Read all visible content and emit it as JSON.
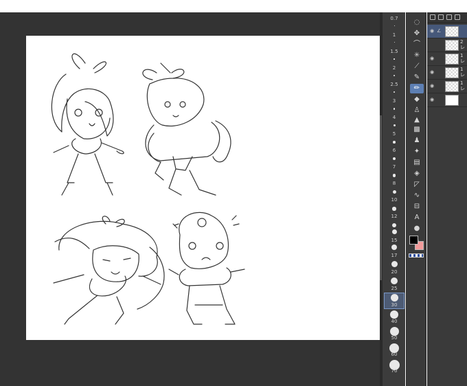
{
  "brush_sizes": [
    {
      "label": "0.7"
    },
    {
      "label": "1"
    },
    {
      "label": "1.5"
    },
    {
      "label": "2"
    },
    {
      "label": "2.5"
    },
    {
      "label": "3"
    },
    {
      "label": "4"
    },
    {
      "label": "5"
    },
    {
      "label": "6"
    },
    {
      "label": "7"
    },
    {
      "label": "8"
    },
    {
      "label": "10"
    },
    {
      "label": "12"
    },
    {
      "label": "15"
    },
    {
      "label": "17"
    },
    {
      "label": "20"
    },
    {
      "label": "25"
    },
    {
      "label": "30"
    },
    {
      "label": "40"
    },
    {
      "label": "50"
    },
    {
      "label": "60"
    },
    {
      "label": "70"
    }
  ],
  "selected_brush_size": "30",
  "tools": [
    {
      "name": "lasso-select-tool-icon",
      "glyph": "◌"
    },
    {
      "name": "move-tool-icon",
      "glyph": "✥"
    },
    {
      "name": "lasso-icon",
      "glyph": "⌒"
    },
    {
      "name": "magic-wand-icon",
      "glyph": "✳"
    },
    {
      "name": "eyedropper-icon",
      "glyph": "⟋"
    },
    {
      "name": "pen-icon",
      "glyph": "✎"
    },
    {
      "name": "pencil-tool-icon",
      "glyph": "✏"
    },
    {
      "name": "eraser-icon",
      "glyph": "◆"
    },
    {
      "name": "blend-tool-icon",
      "glyph": "♙"
    },
    {
      "name": "airbrush-icon",
      "glyph": "▲"
    },
    {
      "name": "decoration-icon",
      "glyph": "▩"
    },
    {
      "name": "stamp-icon",
      "glyph": "♟"
    },
    {
      "name": "sparkle-icon",
      "glyph": "✦"
    },
    {
      "name": "gradient-icon",
      "glyph": "▤"
    },
    {
      "name": "fill-bucket-icon",
      "glyph": "◈"
    },
    {
      "name": "figure-tool-icon",
      "glyph": "◸"
    },
    {
      "name": "curve-ruler-icon",
      "glyph": "∿"
    },
    {
      "name": "frame-icon",
      "glyph": "⊟"
    },
    {
      "name": "text-tool-icon",
      "glyph": "A"
    },
    {
      "name": "balloon-icon",
      "glyph": "●"
    },
    {
      "name": "object-select-icon",
      "glyph": "↖"
    }
  ],
  "active_tool_index": 6,
  "colors": {
    "main": "#000000",
    "sub": "#f29b9b",
    "canvas_bg": "#333333",
    "paper": "#ffffff",
    "selection": "#5d7fb3"
  },
  "layers": [
    {
      "name": "",
      "thumb": "checker",
      "visible": true,
      "selected": true
    },
    {
      "name": "2\nレ",
      "thumb": "checker",
      "visible": false,
      "selected": false
    },
    {
      "name": "1\nレ",
      "thumb": "checker",
      "visible": true,
      "selected": false
    },
    {
      "name": "1\nレ",
      "thumb": "checker",
      "visible": true,
      "selected": false
    },
    {
      "name": "1\nレ",
      "thumb": "checker",
      "visible": true,
      "selected": false
    },
    {
      "name": "",
      "thumb": "white",
      "visible": true,
      "selected": false
    }
  ]
}
